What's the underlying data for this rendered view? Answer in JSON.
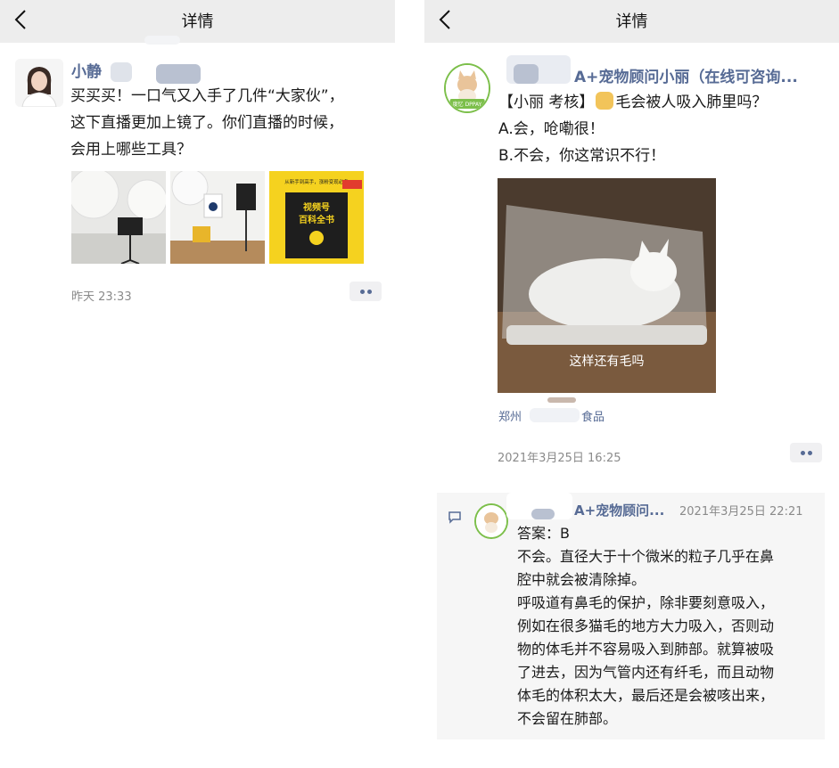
{
  "left": {
    "nav_title": "详情",
    "author_name": "小静",
    "post_lines": [
      "买买买！一口气又入手了几件“大家伙”，",
      "这下直播更加上镜了。你们直播的时候，",
      "会用上哪些工具？"
    ],
    "book_cover": {
      "top_text": "从新手到高手，涨粉变现必备",
      "title_1": "视频号",
      "title_2": "百科全书"
    },
    "timestamp": "昨天 23:33"
  },
  "right": {
    "nav_title": "详情",
    "author_name": "A+宠物顾问小丽（在线可咨询...",
    "avatar_tag": "度忆 DPPAY",
    "post_line_1": "【小丽 考核】",
    "post_line_1_b": "毛会被人吸入肺里吗？",
    "post_lines": [
      "A.会，呛嘞很！",
      "B.不会，你这常识不行！"
    ],
    "image_caption": "这样还有毛吗",
    "location_1": "郑州",
    "location_2": "食品",
    "timestamp": "2021年3月25日 16:25",
    "comment": {
      "author": "A+宠物顾问...",
      "time": "2021年3月25日 22:21",
      "lines": [
        "答案：B",
        "不会。直径大于十个微米的粒子几乎在鼻",
        "腔中就会被清除掉。",
        "呼吸道有鼻毛的保护，除非要刻意吸入，",
        "例如在很多猫毛的地方大力吸入，否则动",
        "物的体毛并不容易吸入到肺部。就算被吸",
        "了进去，因为气管内还有纤毛，而且动物",
        "体毛的体积太大，最后还是会被咳出来，",
        "不会留在肺部。"
      ]
    }
  },
  "colors": {
    "link": "#576b95",
    "nav_bg": "#ededed",
    "comment_bg": "#f6f6f6",
    "avatar_ring": "#7cbf4a"
  }
}
